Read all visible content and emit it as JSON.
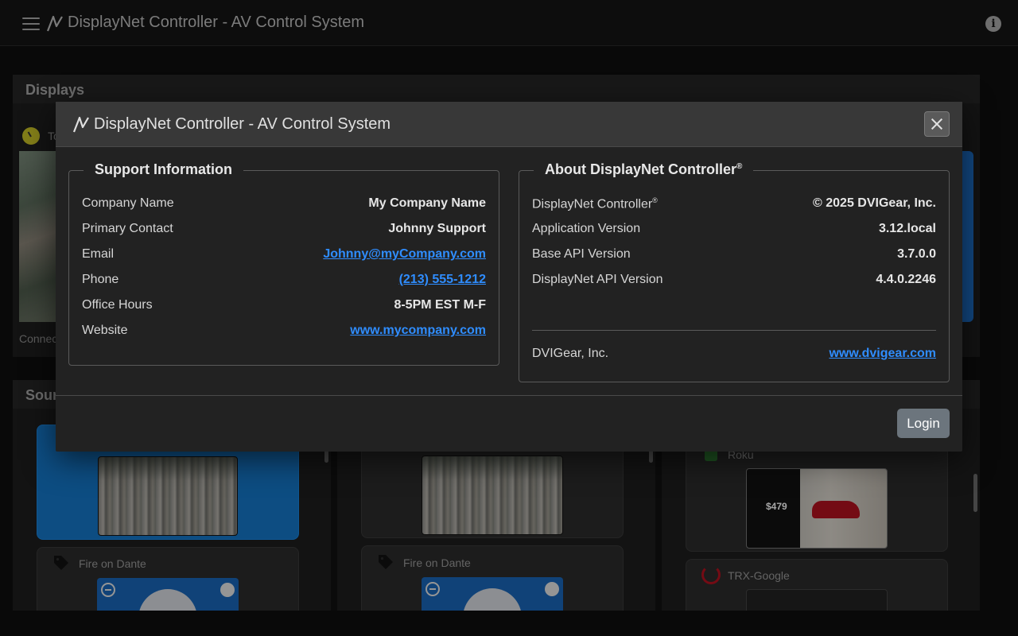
{
  "app": {
    "title": "DisplayNet Controller - AV Control System"
  },
  "background": {
    "displays_header": "Displays",
    "display_card": {
      "name_partial": "To",
      "status_partial": "Connec"
    },
    "sources_header_partial": "Sour",
    "sources": [
      {
        "label": "Fire on Dante"
      },
      {
        "label": "Fire on Dante"
      },
      {
        "label": "Roku"
      },
      {
        "label": "TRX-Google"
      }
    ],
    "roku_price": "$479"
  },
  "modal": {
    "title": "DisplayNet Controller - AV Control System",
    "support": {
      "legend": "Support Information",
      "rows": [
        {
          "label": "Company Name",
          "value": "My Company Name"
        },
        {
          "label": "Primary Contact",
          "value": "Johnny Support"
        },
        {
          "label": "Email",
          "value": "Johnny@myCompany.com"
        },
        {
          "label": "Phone",
          "value": "(213) 555-1212"
        },
        {
          "label": "Office Hours",
          "value": "8-5PM EST M-F"
        },
        {
          "label": "Website",
          "value": "www.mycompany.com"
        }
      ]
    },
    "about": {
      "legend": "About DisplayNet Controller",
      "legend_sup": "®",
      "rows": [
        {
          "label": "DisplayNet Controller",
          "label_sup": "®",
          "value": "© 2025 DVIGear, Inc."
        },
        {
          "label": "Application Version",
          "value": "3.12.local"
        },
        {
          "label": "Base API Version",
          "value": "3.7.0.0"
        },
        {
          "label": "DisplayNet API Version",
          "value": "4.4.0.2246"
        }
      ],
      "company": {
        "label": "DVIGear, Inc.",
        "value": "www.dvigear.com"
      }
    },
    "login_label": "Login"
  },
  "colors": {
    "link": "#2f8dff",
    "selected_card": "#1577c8",
    "login_button": "#6c757d"
  },
  "icons": {
    "menu": "hamburger-icon",
    "logo": "displaynet-logo-icon",
    "info": "info-icon",
    "close": "close-icon",
    "tag": "tag-icon"
  }
}
